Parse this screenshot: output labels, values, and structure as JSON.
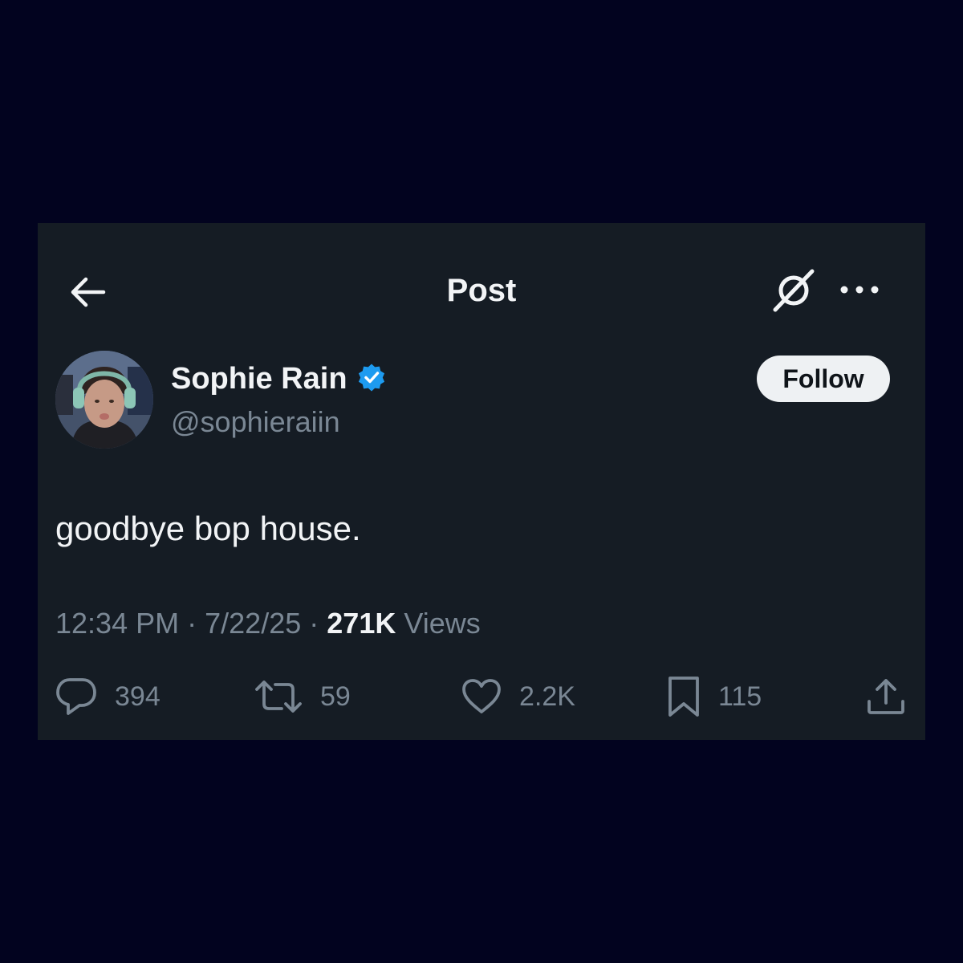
{
  "header": {
    "title": "Post"
  },
  "author": {
    "display_name": "Sophie Rain",
    "handle": "@sophieraiin",
    "verified": true
  },
  "follow_label": "Follow",
  "post": {
    "text": "goodbye bop house.",
    "time": "12:34 PM",
    "separator": "·",
    "date": "7/22/25",
    "views_count": "271K",
    "views_label": "Views"
  },
  "actions": {
    "replies": "394",
    "reposts": "59",
    "likes": "2.2K",
    "bookmarks": "115"
  },
  "icons": {
    "back": "arrow-left-icon",
    "grok": "grok-icon",
    "more": "more-dots-icon",
    "verified": "verified-badge-icon",
    "reply": "reply-icon",
    "repost": "repost-icon",
    "like": "heart-icon",
    "bookmark": "bookmark-icon",
    "share": "share-icon"
  },
  "colors": {
    "page_background": "#02031f",
    "card_background": "#151c24",
    "primary_text": "#f2f4f6",
    "secondary_text": "#7a8794",
    "verified_blue": "#1d9bf0",
    "follow_button": "#eef1f3"
  }
}
